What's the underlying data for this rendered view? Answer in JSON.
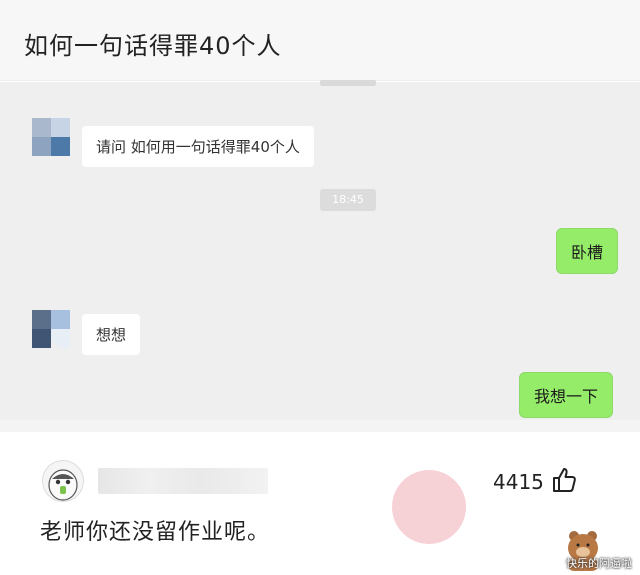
{
  "header": {
    "title": "如何一句话得罪40个人"
  },
  "chat": {
    "messages": [
      {
        "side": "left",
        "text": "请问 如何用一句话得罪40个人"
      },
      {
        "side": "right",
        "text": "卧槽"
      },
      {
        "side": "left",
        "text": "想想"
      },
      {
        "side": "right",
        "text": "我想一下"
      }
    ],
    "timestamp": "18:45"
  },
  "comment": {
    "likes": "4415",
    "text": "老师你还没留作业呢。"
  },
  "watermark": {
    "text": "快乐的阿逼啦"
  },
  "colors": {
    "bubble_right": "#95ec69",
    "chat_bg": "#efefef"
  },
  "icons": [
    "thumb-up-icon",
    "avatar-icon"
  ]
}
